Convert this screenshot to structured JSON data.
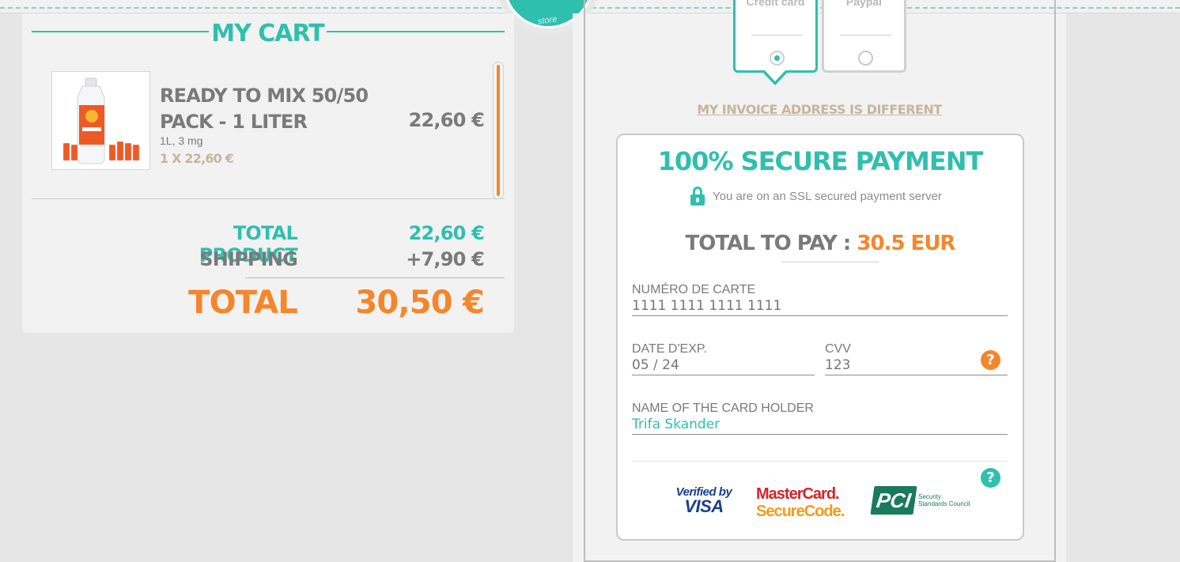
{
  "header": {
    "badge_text": "store"
  },
  "cart": {
    "title": "MY CART",
    "item": {
      "name": "READY TO MIX 50/50 PACK - 1 LITER",
      "variant": "1L, 3 mg",
      "quantity_line": "1 X 22,60 €",
      "price": "22,60 €",
      "image_icon": "product-bottle-image"
    },
    "total_product_label": "TOTAL PRODUCT",
    "total_product_value": "22,60 €",
    "shipping_label": "SHIPPING",
    "shipping_value": "+7,90 €",
    "total_label": "TOTAL",
    "total_value": "30,50 €"
  },
  "payment_methods": {
    "credit_card_label": "Credit card",
    "paypal_label": "Paypal",
    "selected": "Credit card"
  },
  "invoice_link": "MY INVOICE ADDRESS IS DIFFERENT",
  "secure": {
    "title": "100% SECURE PAYMENT",
    "ssl_text": "You are on an SSL secured payment server",
    "total_to_pay_label": "TOTAL TO PAY : ",
    "total_to_pay_value": "30.5 EUR",
    "card_number_label": "NUMÉRO DE CARTE",
    "card_number_placeholder": "1111 1111 1111 1111",
    "exp_label": "DATE D'EXP.",
    "exp_placeholder": "05 / 24",
    "cvv_label": "CVV",
    "cvv_placeholder": "123",
    "holder_label": "NAME OF THE CARD HOLDER",
    "holder_value": "Trifa Skander",
    "help_symbol": "?"
  },
  "logos": {
    "visa_line1": "Verified by",
    "visa_line2": "VISA",
    "mc_line1": "MasterCard.",
    "mc_line2": "SecureCode.",
    "pci_mark": "PCI",
    "pci_text": "Security Standards Council"
  },
  "colors": {
    "teal": "#2fbfae",
    "orange": "#f5862a",
    "beige": "#c7b59b",
    "gray_text": "#7a7a7a"
  }
}
